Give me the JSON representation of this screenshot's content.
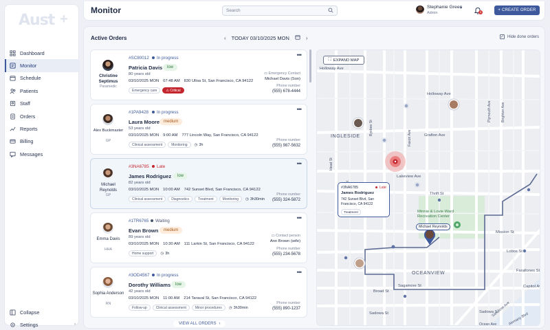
{
  "app": {
    "logo": "Aust",
    "page_title": "Monitor"
  },
  "sidebar": {
    "items": [
      {
        "label": "Dashboard",
        "icon": "grid-icon"
      },
      {
        "label": "Monitor",
        "icon": "monitor-icon",
        "active": true
      },
      {
        "label": "Schedule",
        "icon": "calendar-icon"
      },
      {
        "label": "Patients",
        "icon": "users-icon"
      },
      {
        "label": "Staff",
        "icon": "staff-icon"
      },
      {
        "label": "Orders",
        "icon": "orders-icon"
      },
      {
        "label": "Reports",
        "icon": "reports-icon"
      },
      {
        "label": "Billing",
        "icon": "billing-icon"
      },
      {
        "label": "Messages",
        "icon": "message-icon"
      }
    ],
    "collapse_label": "Collapse",
    "settings_label": "Settings"
  },
  "header": {
    "search_placeholder": "Search",
    "user": {
      "name": "Stephanie Green",
      "role": "Admin"
    },
    "notification_count": "3",
    "create_label": "CREATE ORDER"
  },
  "main": {
    "section_title": "Active Orders",
    "date_label": "TODAY 03/10/2025 MON",
    "hide_done_label": "Hide done orders",
    "view_all_label": "VIEW ALL ORDERS"
  },
  "orders": [
    {
      "id": "#SC80012",
      "status": "In progress",
      "status_color": "#3f5a9c",
      "staff_name": "Christine Septimus",
      "staff_role": "Paramedic",
      "patient": "Patricia Davis",
      "priority": "low",
      "age": "80 years old",
      "date": "03/10/2025 MON",
      "time": "07:48 AM",
      "address": "830 Ulloa St, San Francisco, CA 94122",
      "contact_label": "Emergency Contact",
      "contact": "Michael Davis (Son)",
      "phone_label": "Phone number",
      "phone": "(555) 678-4444",
      "tags": [
        "Emergency care"
      ],
      "critical": "Critical",
      "duration": ""
    },
    {
      "id": "#1PA9428",
      "status": "In progress",
      "status_color": "#3f5a9c",
      "staff_name": "Alex Buckmaster",
      "staff_role": "GP",
      "patient": "Laura Moore",
      "priority": "medium",
      "age": "53 years old",
      "date": "03/10/2025 MON",
      "time": "9:00 AM",
      "address": "777 Lincoln Way, San Francisco, CA 94122",
      "contact_label": "",
      "contact": "",
      "phone_label": "Phone number",
      "phone": "(555) 987-5632",
      "tags": [
        "Clinical assessment",
        "Monitoring"
      ],
      "critical": "",
      "duration": "3h"
    },
    {
      "id": "#3NA6785",
      "status": "Late",
      "status_color": "#c4262e",
      "staff_name": "Michael Reynolds",
      "staff_role": "GP",
      "patient": "James Rodriguez",
      "priority": "low",
      "age": "82 years old",
      "date": "03/10/2025 MON",
      "time": "10:00 AM",
      "address": "742 Sunset Blvd, San Francisco, CA 94122",
      "contact_label": "",
      "contact": "",
      "phone_label": "Phone number",
      "phone": "(555) 324-5872",
      "tags": [
        "Clinical assessment",
        "Diagnostics",
        "Treatment",
        "Monitoring"
      ],
      "critical": "",
      "duration": "3h30min"
    },
    {
      "id": "#1TR6765",
      "status": "Waiting",
      "status_color": "#4a5570",
      "staff_name": "Emma Davis",
      "staff_role": "HHA",
      "patient": "Evan Brown",
      "priority": "medium",
      "age": "89 years old",
      "date": "03/10/2025 MON",
      "time": "10:30 AM",
      "address": "111 Larkin St, San Francisco, CA 94122",
      "contact_label": "Contact person",
      "contact": "Ann Brown (wife)",
      "phone_label": "Phone number",
      "phone": "(555) 234-5678",
      "tags": [
        "Home support"
      ],
      "critical": "",
      "duration": "3h"
    },
    {
      "id": "#3OD4567",
      "status": "In progress",
      "status_color": "#3f5a9c",
      "staff_name": "Sophia Anderson",
      "staff_role": "RN",
      "patient": "Dorothy Williams",
      "priority": "low",
      "age": "42 years old",
      "date": "03/10/2025 MON",
      "time": "11:00 AM",
      "address": "214 Taraval St, San Francisco, CA 94122",
      "contact_label": "",
      "contact": "",
      "phone_label": "Phone number",
      "phone": "(555) 890-1237",
      "tags": [
        "Follow-up",
        "Clinical assessment",
        "Minor procedures"
      ],
      "critical": "",
      "duration": "3h30min"
    }
  ],
  "map": {
    "expand_label": "EXPAND MAP",
    "streets": [
      "Holloway Ave",
      "Holloway Ave",
      "INGLESIDE",
      "Grafton Ave",
      "Lakeview Ave",
      "Thrift St",
      "Minnie & Lovie Ward Recreation Center",
      "Mission St",
      "Lobos St",
      "OCEANVIEW",
      "Farallones St",
      "Broad St",
      "Sagamore St",
      "Sadowa St",
      "Sadowa St",
      "Capitol Ave",
      "Faxon Ave",
      "Plymouth Ave",
      "Brighton Ave",
      "Head St",
      "Bright St",
      "Byxbee St",
      "San Jose Ave",
      "Alemany Blvd",
      "Ocean Ave"
    ],
    "popup": {
      "id": "#3NA6785",
      "status": "Late",
      "patient": "James Rodriguez",
      "address": "742 Sunset Blvd, San Francisco, CA 94122",
      "tag": "Treatment"
    },
    "marker_label": "Michael Reynolds"
  },
  "colors": {
    "accent": "#3f5a9c",
    "late": "#c4262e",
    "low": "#2f7a3c",
    "medium": "#a65818"
  }
}
